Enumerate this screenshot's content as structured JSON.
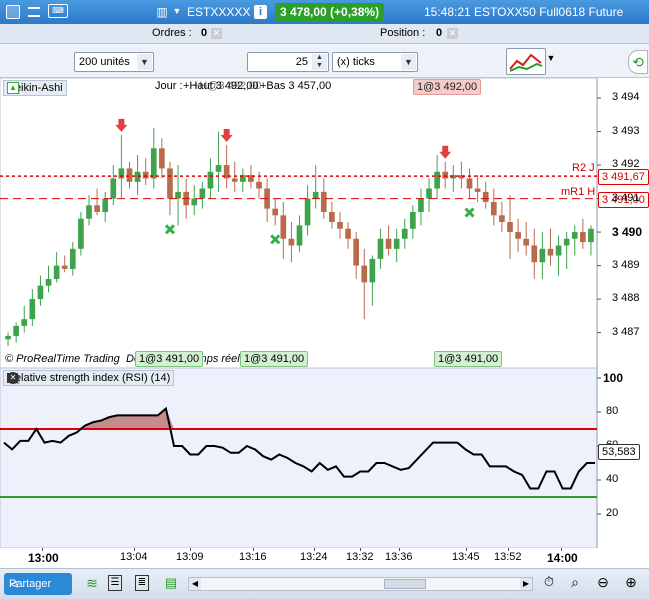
{
  "titlebar": {
    "instrument": "ESTXXXXX",
    "price_badge": "3 478,00 (+0,38%)",
    "time_and_name": "15:48:21 ESTOXX50 Full0618 Future"
  },
  "orders_bar": {
    "orders_label": "Ordres :",
    "orders_value": "0",
    "position_label": "Position :",
    "position_value": "0"
  },
  "toolbar": {
    "quantity": "200 unités",
    "ticks_value": "25",
    "ticks_unit": "(x) ticks"
  },
  "chart": {
    "indicator_name": "Heikin-Ashi",
    "info_prefix": "Jour :",
    "info_haut": "+Haut 3 492,00",
    "info_bas": "+Bas 3 457,00",
    "info_overlap": "+H@3 492,00",
    "top_order_tag": "1@3 492,00",
    "bottom_order_tags": [
      "1@3 491,00",
      "1@3 491,00",
      "1@3 491,00"
    ],
    "watermark_left": "© ProRealTime Trading",
    "watermark_right": "Données en temps réel",
    "levels": [
      {
        "name": "R2 J",
        "value": "3 491,67"
      },
      {
        "name": "mR1 H",
        "value": "3 491,00"
      }
    ],
    "y_ticks": [
      "3 494",
      "3 493",
      "3 492",
      "3 491",
      "3 490",
      "3 489",
      "3 488",
      "3 487"
    ],
    "current_label": "3 490",
    "colors": {
      "up": "#3ea34a",
      "down": "#b86b4b",
      "level": "#d00000"
    }
  },
  "rsi": {
    "title": "Relative strength index (RSI) (14)",
    "y_ticks": [
      "100",
      "80",
      "60",
      "40",
      "20"
    ],
    "current_value": "53,583",
    "overbought": 70,
    "oversold": 30
  },
  "xaxis": {
    "ticks": [
      "13:00",
      "13:04",
      "13:09",
      "13:16",
      "13:24",
      "13:32",
      "13:36",
      "13:45",
      "13:52",
      "14:00"
    ]
  },
  "bottombar": {
    "share_label": "Partager"
  },
  "chart_data": {
    "type": "candlestick",
    "x_start": "12:57",
    "interval": "30s",
    "ylim": [
      3486.6,
      3494.3
    ],
    "candles": [
      [
        3486.8,
        3487.0,
        3486.6,
        3486.9
      ],
      [
        3486.9,
        3487.3,
        3486.7,
        3487.2
      ],
      [
        3487.2,
        3487.8,
        3487.0,
        3487.4
      ],
      [
        3487.4,
        3488.3,
        3487.2,
        3488.0
      ],
      [
        3488.0,
        3488.7,
        3487.8,
        3488.4
      ],
      [
        3488.4,
        3489.0,
        3488.2,
        3488.6
      ],
      [
        3488.6,
        3489.4,
        3488.5,
        3489.0
      ],
      [
        3489.0,
        3489.3,
        3488.8,
        3488.9
      ],
      [
        3488.9,
        3489.7,
        3488.7,
        3489.5
      ],
      [
        3489.5,
        3490.6,
        3489.3,
        3490.4
      ],
      [
        3490.4,
        3491.1,
        3490.2,
        3490.8
      ],
      [
        3490.8,
        3491.3,
        3490.5,
        3490.6
      ],
      [
        3490.6,
        3491.2,
        3490.3,
        3491.0
      ],
      [
        3491.0,
        3492.0,
        3490.8,
        3491.6
      ],
      [
        3491.6,
        3492.9,
        3491.0,
        3491.9
      ],
      [
        3491.9,
        3492.1,
        3491.3,
        3491.5
      ],
      [
        3491.5,
        3492.3,
        3491.1,
        3491.8
      ],
      [
        3491.8,
        3492.2,
        3491.4,
        3491.6
      ],
      [
        3491.6,
        3493.1,
        3491.3,
        3492.5
      ],
      [
        3492.5,
        3492.8,
        3491.6,
        3491.9
      ],
      [
        3491.9,
        3492.1,
        3490.5,
        3491.0
      ],
      [
        3491.0,
        3492.0,
        3490.2,
        3491.2
      ],
      [
        3491.2,
        3491.6,
        3490.4,
        3490.8
      ],
      [
        3490.8,
        3491.4,
        3490.5,
        3491.0
      ],
      [
        3491.0,
        3491.5,
        3490.7,
        3491.3
      ],
      [
        3491.3,
        3492.2,
        3491.0,
        3491.8
      ],
      [
        3491.8,
        3493.0,
        3491.2,
        3492.0
      ],
      [
        3492.0,
        3492.6,
        3491.3,
        3491.6
      ],
      [
        3491.6,
        3492.1,
        3491.2,
        3491.5
      ],
      [
        3491.5,
        3491.9,
        3491.2,
        3491.7
      ],
      [
        3491.7,
        3492.0,
        3491.3,
        3491.5
      ],
      [
        3491.5,
        3491.8,
        3491.0,
        3491.3
      ],
      [
        3491.3,
        3491.6,
        3490.3,
        3490.7
      ],
      [
        3490.7,
        3491.0,
        3490.2,
        3490.5
      ],
      [
        3490.5,
        3490.9,
        3489.2,
        3489.8
      ],
      [
        3489.8,
        3490.3,
        3489.1,
        3489.6
      ],
      [
        3489.6,
        3490.5,
        3489.4,
        3490.2
      ],
      [
        3490.2,
        3491.4,
        3489.9,
        3491.0
      ],
      [
        3491.0,
        3492.0,
        3490.7,
        3491.2
      ],
      [
        3491.2,
        3491.6,
        3490.4,
        3490.6
      ],
      [
        3490.6,
        3490.9,
        3490.1,
        3490.3
      ],
      [
        3490.3,
        3490.6,
        3489.8,
        3490.1
      ],
      [
        3490.1,
        3490.3,
        3489.5,
        3489.8
      ],
      [
        3489.8,
        3490.0,
        3488.6,
        3489.0
      ],
      [
        3489.0,
        3489.5,
        3487.4,
        3488.5
      ],
      [
        3488.5,
        3489.3,
        3487.8,
        3489.2
      ],
      [
        3489.2,
        3490.1,
        3488.9,
        3489.8
      ],
      [
        3489.8,
        3490.2,
        3489.3,
        3489.5
      ],
      [
        3489.5,
        3490.1,
        3489.1,
        3489.8
      ],
      [
        3489.8,
        3490.4,
        3489.5,
        3490.1
      ],
      [
        3490.1,
        3490.8,
        3489.8,
        3490.6
      ],
      [
        3490.6,
        3491.3,
        3490.2,
        3491.0
      ],
      [
        3491.0,
        3491.6,
        3490.6,
        3491.3
      ],
      [
        3491.3,
        3492.3,
        3491.0,
        3491.8
      ],
      [
        3491.8,
        3492.1,
        3491.3,
        3491.6
      ],
      [
        3491.6,
        3492.0,
        3491.2,
        3491.7
      ],
      [
        3491.7,
        3492.1,
        3491.3,
        3491.6
      ],
      [
        3491.6,
        3491.9,
        3491.0,
        3491.3
      ],
      [
        3491.3,
        3491.7,
        3490.9,
        3491.2
      ],
      [
        3491.2,
        3491.5,
        3490.7,
        3490.9
      ],
      [
        3490.9,
        3491.3,
        3490.2,
        3490.5
      ],
      [
        3490.5,
        3490.9,
        3490.0,
        3490.3
      ],
      [
        3490.3,
        3491.1,
        3489.2,
        3490.0
      ],
      [
        3490.0,
        3490.4,
        3489.4,
        3489.8
      ],
      [
        3489.8,
        3490.3,
        3489.3,
        3489.6
      ],
      [
        3489.6,
        3490.1,
        3488.6,
        3489.1
      ],
      [
        3489.1,
        3490.0,
        3488.6,
        3489.5
      ],
      [
        3489.5,
        3490.1,
        3489.0,
        3489.3
      ],
      [
        3489.3,
        3489.9,
        3488.7,
        3489.6
      ],
      [
        3489.6,
        3490.0,
        3488.9,
        3489.8
      ],
      [
        3489.8,
        3490.2,
        3489.3,
        3490.0
      ],
      [
        3490.0,
        3490.4,
        3489.5,
        3489.7
      ],
      [
        3489.7,
        3490.2,
        3489.3,
        3490.1
      ]
    ],
    "markers": {
      "sell_arrows": [
        14,
        27,
        54
      ],
      "buy_crosses": [
        20,
        33,
        57
      ]
    },
    "rsi_series": [
      62,
      58,
      63,
      63,
      70,
      62,
      63,
      62,
      66,
      68,
      72,
      74,
      75,
      77,
      78,
      78,
      78,
      78,
      78,
      78,
      82,
      60,
      60,
      55,
      55,
      60,
      60,
      59,
      56,
      56,
      60,
      58,
      54,
      52,
      55,
      53,
      50,
      48,
      45,
      50,
      46,
      48,
      42,
      42,
      45,
      45,
      50,
      50,
      48,
      46,
      47,
      52,
      57,
      62,
      62,
      62,
      62,
      58,
      55,
      55,
      48,
      48,
      48,
      45,
      43,
      35,
      35,
      45,
      45,
      35,
      35,
      45,
      50,
      50
    ]
  }
}
